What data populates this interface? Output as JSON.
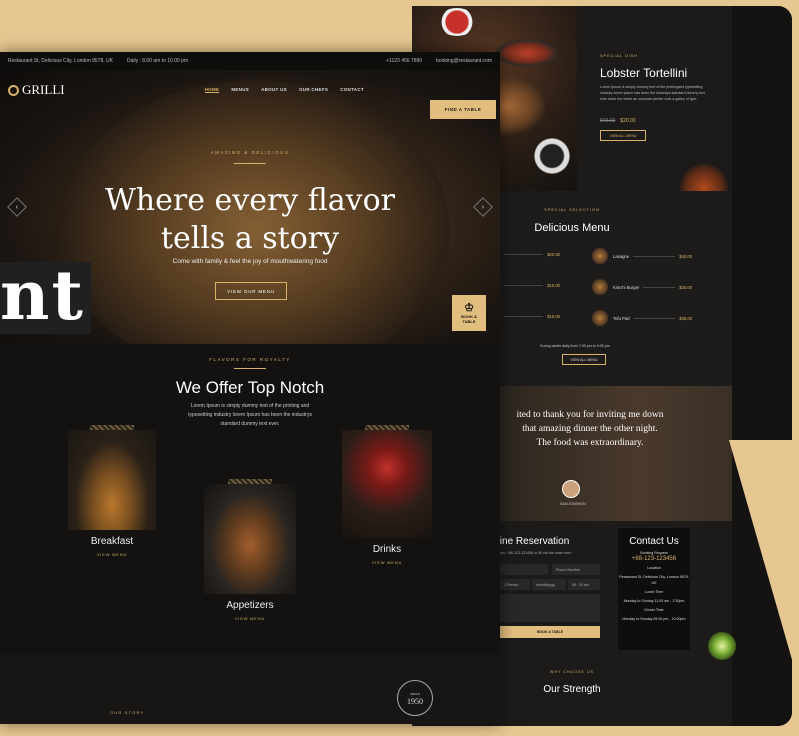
{
  "topbar": {
    "address": "Restaurant St, Delicious City, London 9578, UK",
    "hours": "Daily : 8.00 am to 10.00 pm",
    "phone": "+1123 456 7890",
    "email": "booking@restaurant.com"
  },
  "brand": {
    "name": "GRILLI",
    "tagline": "RESTAURANT"
  },
  "nav": {
    "items": [
      "HOME",
      "MENUS",
      "ABOUT US",
      "OUR CHEFS",
      "CONTACT"
    ],
    "cta": "FIND A TABLE"
  },
  "hero": {
    "kicker": "AMAZING & DELICIOUS",
    "title_line1": "Where every flavor",
    "title_line2": "tells a story",
    "subtitle": "Come with family & feel the joy of mouthwatering food",
    "button": "VIEW OUR MENU",
    "book_label_1": "BOOK A",
    "book_label_2": "TABLE"
  },
  "overlay_text": "nt",
  "offer": {
    "kicker": "FLAVORS FOR ROYALTY",
    "title": "We Offer Top Notch",
    "description": "Lorem Ipsum is simply dummy text of the printing and typesetting industry lorem Ipsum has been the industrys standard dummy text ever.",
    "dishes": [
      {
        "name": "Breakfast",
        "link": "VIEW MENU"
      },
      {
        "name": "Appetizers",
        "link": "VIEW MENU"
      },
      {
        "name": "Drinks",
        "link": "VIEW MENU"
      }
    ]
  },
  "story": {
    "kicker": "OUR STORY",
    "since_label": "SINCE",
    "since_year": "1950"
  },
  "special": {
    "kicker": "SPECIAL DISH",
    "title": "Lobster Tortellini",
    "description": "Lorem Ipsum is simply dummy text of the printingand typesetting industry lorem Ipsum has been the industrys standard dummy text ever since the when an unknown printer took a galley of type.",
    "old_price": "$40.00",
    "price": "$20.00",
    "button": "VIEW ALL MENU"
  },
  "menu": {
    "kicker": "SPECIAL SELECTION",
    "title": "Delicious Menu",
    "items": [
      {
        "name": "",
        "price": "$20.50"
      },
      {
        "name": "Lasagne",
        "price": "$40.00"
      },
      {
        "name": "",
        "price": "$10.00"
      },
      {
        "name": "Kimchi Burger",
        "price": "$35.00"
      },
      {
        "name": "",
        "price": "$15.00"
      },
      {
        "name": "Tofu Pad",
        "price": "$45.00"
      }
    ],
    "note": "During winter daily from 7:00 pm to 9:00 pm",
    "button": "VIEW ALL MENU"
  },
  "testimonial": {
    "line1": "ited to thank you for inviting me down",
    "line2": "that amazing dinner the other night.",
    "line3": "The food was extraordinary.",
    "author": "SAM JONSHON"
  },
  "reservation": {
    "title": "nline Reservation",
    "subtitle": "ervation, +88-123-123456 or fill out the order form",
    "phone_placeholder": "Phone Number",
    "people": "1 Person",
    "date": "mm/dd/yyyy",
    "time": "08 : 00 am",
    "button": "BOOK A TABLE"
  },
  "contact": {
    "title": "Contact Us",
    "request_label": "Booking Request",
    "phone": "+88-123-123456",
    "location_label": "Location",
    "address": "Restaurant St, Delicious City, London 9578, UK",
    "lunch_label": "Lunch Time",
    "lunch": "Monday to Sunday 11.00 am - 2.30pm",
    "dinner_label": "Dinner Time",
    "dinner": "Monday to Sunday 05.00 pm - 10.00pm"
  },
  "strength": {
    "kicker": "WHY CHOOSE US",
    "title": "Our Strength"
  },
  "colors": {
    "gold": "#d9b26a",
    "button_gold": "#e2be7e",
    "background": "#e6c791",
    "dark": "#141312"
  }
}
